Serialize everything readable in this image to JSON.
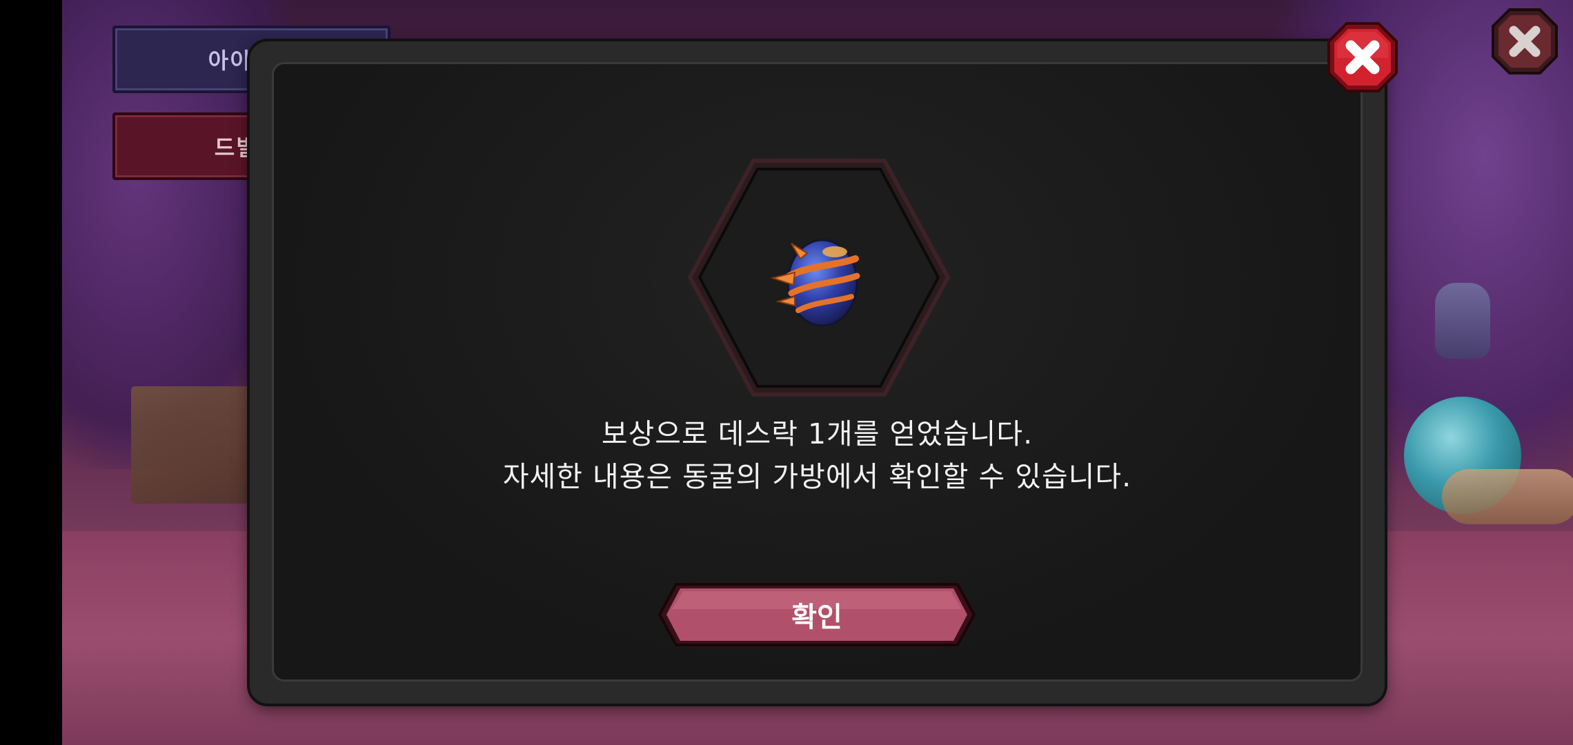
{
  "side_buttons": {
    "item_code_label": "아이템코",
    "dbill_label": "드빌 가"
  },
  "dialog": {
    "message_line1": "보상으로 데스락 1개를 얻었습니다.",
    "message_line2": "자세한 내용은 동굴의 가방에서 확인할 수 있습니다.",
    "confirm_label": "확인",
    "reward_icon": "deathlock-egg-icon"
  },
  "colors": {
    "confirm_button": "#b1506a",
    "close_button": "#c8202e",
    "dialog_bg": "#171717"
  }
}
